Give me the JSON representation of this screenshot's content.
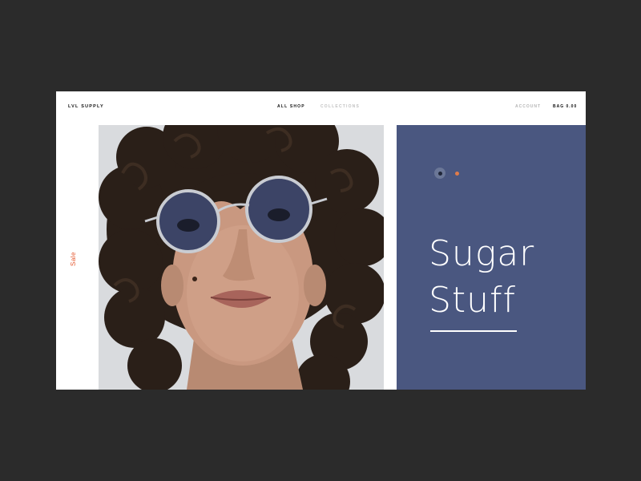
{
  "header": {
    "brand": "LVL SUPPLY",
    "nav": [
      "ALL SHOP",
      "COLLECTIONS"
    ],
    "account_label": "ACCOUNT",
    "bag_label": "BAG 0.00"
  },
  "sidebar": {
    "sale_label": "Sale"
  },
  "hero": {
    "headline_line1": "Sugar",
    "headline_line2": "Stuff",
    "slider": {
      "active_index": 0,
      "count": 2
    }
  },
  "colors": {
    "background": "#2b2b2b",
    "panel": "#4a5780",
    "accent_orange": "#e07b4a",
    "sale_red": "#e4572e"
  }
}
